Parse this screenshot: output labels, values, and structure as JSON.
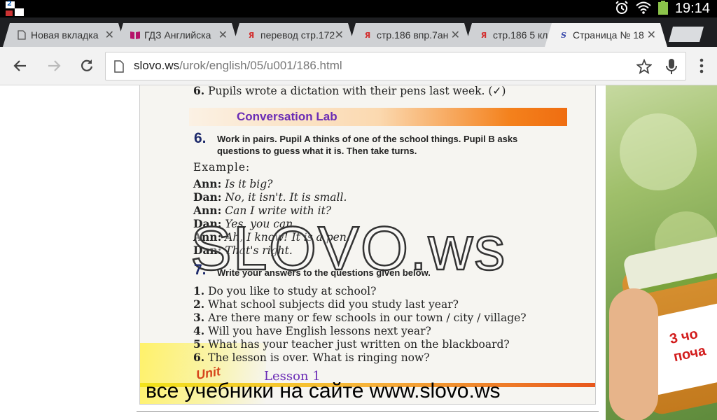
{
  "status_bar": {
    "time": "19:14",
    "notification_badge": "2"
  },
  "tabs": [
    {
      "title": "Новая вкладка",
      "favicon": "page-icon"
    },
    {
      "title": "ГДЗ Английска",
      "favicon": "book-icon"
    },
    {
      "title": "перевод стр.172",
      "favicon": "yandex-icon"
    },
    {
      "title": "стр.186 впр.7ан",
      "favicon": "yandex-icon"
    },
    {
      "title": "стр.186 5 кл",
      "favicon": "yandex-icon"
    },
    {
      "title": "Страница № 18",
      "favicon": "slovo-icon",
      "active": true
    }
  ],
  "toolbar": {
    "url_host": "slovo.ws",
    "url_path": "/urok/english/05/u001/186.html"
  },
  "page": {
    "top_line_num": "6.",
    "top_line": "Pupils wrote a dictation with their pens last week. (✓)",
    "section_title": "Conversation Lab",
    "ex6_num": "6.",
    "ex6_line1": "Work in pairs. Pupil A thinks of one of the school things. Pupil B asks",
    "ex6_line2": "questions to guess what it is. Then take turns.",
    "example_label": "Example:",
    "dialogue": [
      {
        "speaker": "Ann:",
        "text": "Is it big?"
      },
      {
        "speaker": "Dan:",
        "text": "No, it isn't. It is small."
      },
      {
        "speaker": "Ann:",
        "text": "Can I write with it?"
      },
      {
        "speaker": "Dan:",
        "text": "Yes, you can."
      },
      {
        "speaker": "Ann:",
        "text": "Ah, I know! It is a pen."
      },
      {
        "speaker": "Dan:",
        "text": "That's right."
      }
    ],
    "ex7_num": "7.",
    "ex7_instruction": "Write your answers to the questions given below.",
    "questions": [
      {
        "num": "1.",
        "text": "Do you like to study at school?"
      },
      {
        "num": "2.",
        "text": "What school subjects did you study last year?"
      },
      {
        "num": "3.",
        "text": "Are there many or few schools in our town  / city / village?"
      },
      {
        "num": "4.",
        "text": "Will you have English lessons next year?"
      },
      {
        "num": "5.",
        "text": "What has your teacher just written on the blackboard?"
      },
      {
        "num": "6.",
        "text": "The lesson is over. What is ringing now?"
      }
    ],
    "unit_badge": "Unit",
    "lesson_label": "Lesson 1",
    "watermark": "SLOVO.ws",
    "caption": "все учебники на сайте www.slovo.ws"
  },
  "ad": {
    "label_line1": "3 чо",
    "label_line2": "поча"
  }
}
